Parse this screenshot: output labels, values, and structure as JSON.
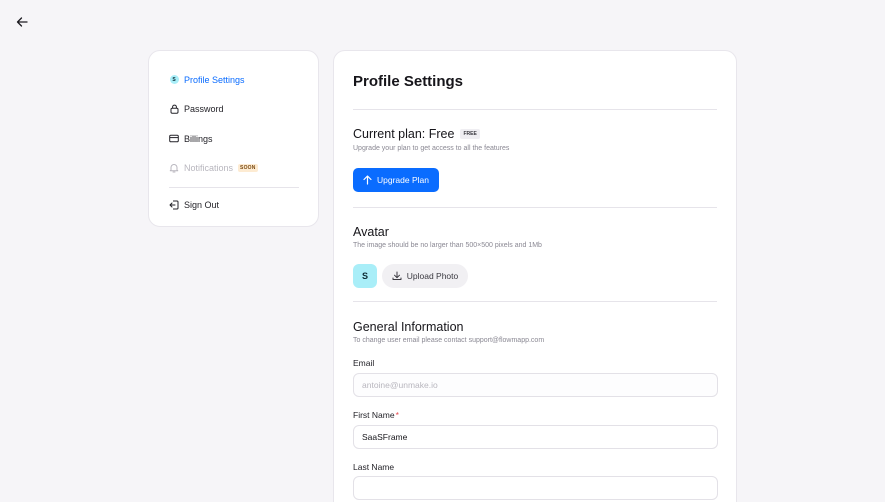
{
  "sidebar": {
    "items": [
      {
        "label": "Profile Settings",
        "badge_letter": "S"
      },
      {
        "label": "Password"
      },
      {
        "label": "Billings"
      },
      {
        "label": "Notifications",
        "badge": "SOON"
      },
      {
        "label": "Sign Out"
      }
    ]
  },
  "main": {
    "title": "Profile Settings",
    "plan": {
      "title": "Current plan: Free",
      "badge": "FREE",
      "subtitle": "Upgrade your plan to get access to all the features",
      "button": "Upgrade Plan"
    },
    "avatar": {
      "title": "Avatar",
      "subtitle": "The image should be no larger than 500×500 pixels and 1Mb",
      "letter": "S",
      "upload_button": "Upload Photo"
    },
    "general": {
      "title": "General Information",
      "subtitle": "To change user email please contact support@flowmapp.com",
      "email_label": "Email",
      "email_value": "antoine@unmake.io",
      "first_name_label": "First Name",
      "required_mark": "*",
      "first_name_value": "SaaSFrame",
      "last_name_label": "Last Name",
      "last_name_value": ""
    }
  },
  "colors": {
    "accent": "#0a6cff",
    "avatar_bg": "#a9eef8",
    "soon_badge_bg": "#fdebd2",
    "required": "#e5484d"
  },
  "icons": [
    "arrow-left-icon",
    "lock-icon",
    "credit-card-icon",
    "bell-icon",
    "sign-out-icon",
    "arrow-up-icon",
    "download-icon"
  ]
}
